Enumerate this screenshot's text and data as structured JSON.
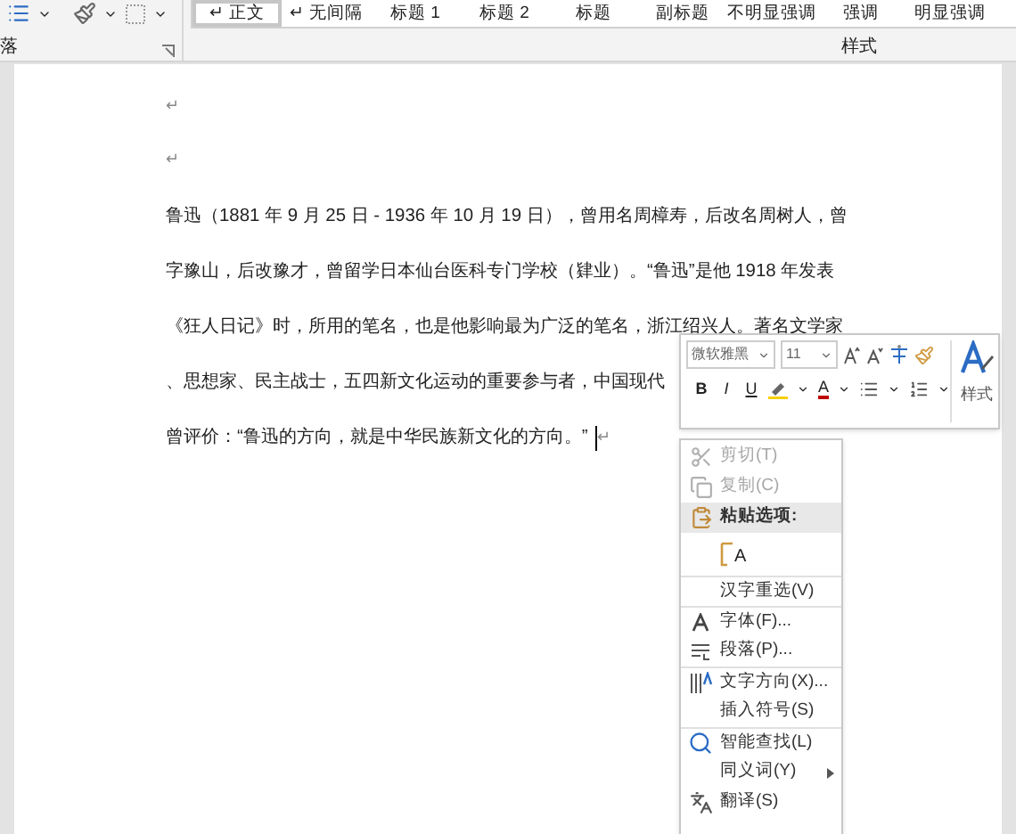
{
  "ribbon": {
    "paragraph_group_label": "落",
    "styles_group_label": "样式",
    "styles": [
      {
        "label": "↵ 正文",
        "selected": true
      },
      {
        "label": "↵ 无间隔",
        "selected": false
      },
      {
        "label": "标题 1",
        "selected": false
      },
      {
        "label": "标题 2",
        "selected": false
      },
      {
        "label": "标题",
        "selected": false
      },
      {
        "label": "副标题",
        "selected": false
      },
      {
        "label": "不明显强调",
        "selected": false
      },
      {
        "label": "强调",
        "selected": false
      },
      {
        "label": "明显强调",
        "selected": false
      }
    ]
  },
  "document": {
    "empty_paragraph_marks": [
      "↵",
      "↵"
    ],
    "lines": [
      "鲁迅（1881 年 9 月 25 日 - 1936 年 10 月 19 日），曾用名周樟寿，后改名周树人，曾",
      "字豫山，后改豫才，曾留学日本仙台医科专门学校（肄业）。“鲁迅”是他 1918 年发表",
      "《狂人日记》时，所用的笔名，也是他影响最为广泛的笔名，浙江绍兴人。著名文学家",
      "、思想家、民主战士，五四新文化运动的重要参与者，中国现代",
      "曾评价：“鲁迅的方向，就是中华民族新文化的方向。”"
    ],
    "end_mark": "↵"
  },
  "mini_toolbar": {
    "font_name": "微软雅黑",
    "font_size": "11",
    "bold": "B",
    "italic": "I",
    "underline": "U",
    "font_color_letter": "A",
    "styles_label": "样式"
  },
  "context_menu": [
    {
      "kind": "item",
      "label": "剪切(T)",
      "disabled": true,
      "separator_before": false,
      "submenu": false
    },
    {
      "kind": "item",
      "label": "复制(C)",
      "disabled": true,
      "separator_before": false,
      "submenu": false
    },
    {
      "kind": "header",
      "label": "粘贴选项:",
      "separator_before": false
    },
    {
      "kind": "paste_option",
      "label": "A",
      "separator_before": false
    },
    {
      "kind": "item",
      "label": "汉字重选(V)",
      "disabled": false,
      "separator_before": true,
      "submenu": false
    },
    {
      "kind": "item",
      "label": "字体(F)...",
      "disabled": false,
      "separator_before": true,
      "submenu": false
    },
    {
      "kind": "item",
      "label": "段落(P)...",
      "disabled": false,
      "separator_before": false,
      "submenu": false
    },
    {
      "kind": "item",
      "label": "文字方向(X)...",
      "disabled": false,
      "separator_before": true,
      "submenu": false
    },
    {
      "kind": "item",
      "label": "插入符号(S)",
      "disabled": false,
      "separator_before": false,
      "submenu": false
    },
    {
      "kind": "item",
      "label": "智能查找(L)",
      "disabled": false,
      "separator_before": true,
      "submenu": false
    },
    {
      "kind": "item",
      "label": "同义词(Y)",
      "disabled": false,
      "separator_before": false,
      "submenu": true
    },
    {
      "kind": "item",
      "label": "翻译(S)",
      "disabled": false,
      "separator_before": false,
      "submenu": false
    }
  ]
}
